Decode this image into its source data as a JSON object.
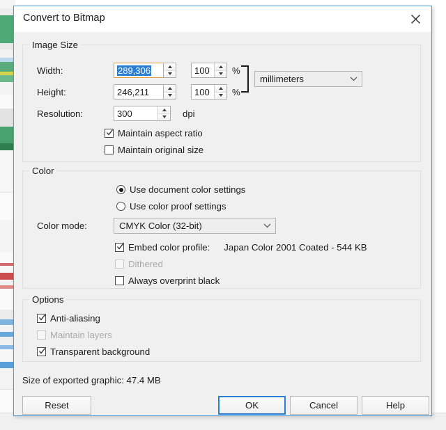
{
  "dialog": {
    "title": "Convert to Bitmap",
    "close_icon": "close-icon"
  },
  "image_size": {
    "legend": "Image Size",
    "width_label": "Width:",
    "width_value": "289,306",
    "width_percent": "100",
    "width_percent_symbol": "%",
    "height_label": "Height:",
    "height_value": "246,211",
    "height_percent": "100",
    "height_percent_symbol": "%",
    "resolution_label": "Resolution:",
    "resolution_value": "300",
    "resolution_unit": "dpi",
    "units_value": "millimeters",
    "maintain_aspect_ratio": "Maintain aspect ratio",
    "maintain_original_size": "Maintain original size"
  },
  "color": {
    "legend": "Color",
    "use_document_color_settings": "Use document color settings",
    "use_color_proof_settings": "Use color proof settings",
    "color_mode_label": "Color mode:",
    "color_mode_value": "CMYK Color (32-bit)",
    "embed_color_profile": "Embed color profile:",
    "embed_color_profile_value": "Japan Color 2001 Coated - 544 KB",
    "dithered": "Dithered",
    "always_overprint_black": "Always overprint black"
  },
  "options": {
    "legend": "Options",
    "anti_aliasing": "Anti-aliasing",
    "maintain_layers": "Maintain layers",
    "transparent_background": "Transparent background"
  },
  "status": {
    "size_of_exported_graphic": "Size of exported graphic: 47.4 MB"
  },
  "buttons": {
    "reset": "Reset",
    "ok": "OK",
    "cancel": "Cancel",
    "help": "Help"
  },
  "colors": {
    "dialog_border": "#4a9ede",
    "selection_blue": "#2a7fd4",
    "focus_orange": "#e59b3a",
    "dialog_bg": "#f0f0f0"
  }
}
